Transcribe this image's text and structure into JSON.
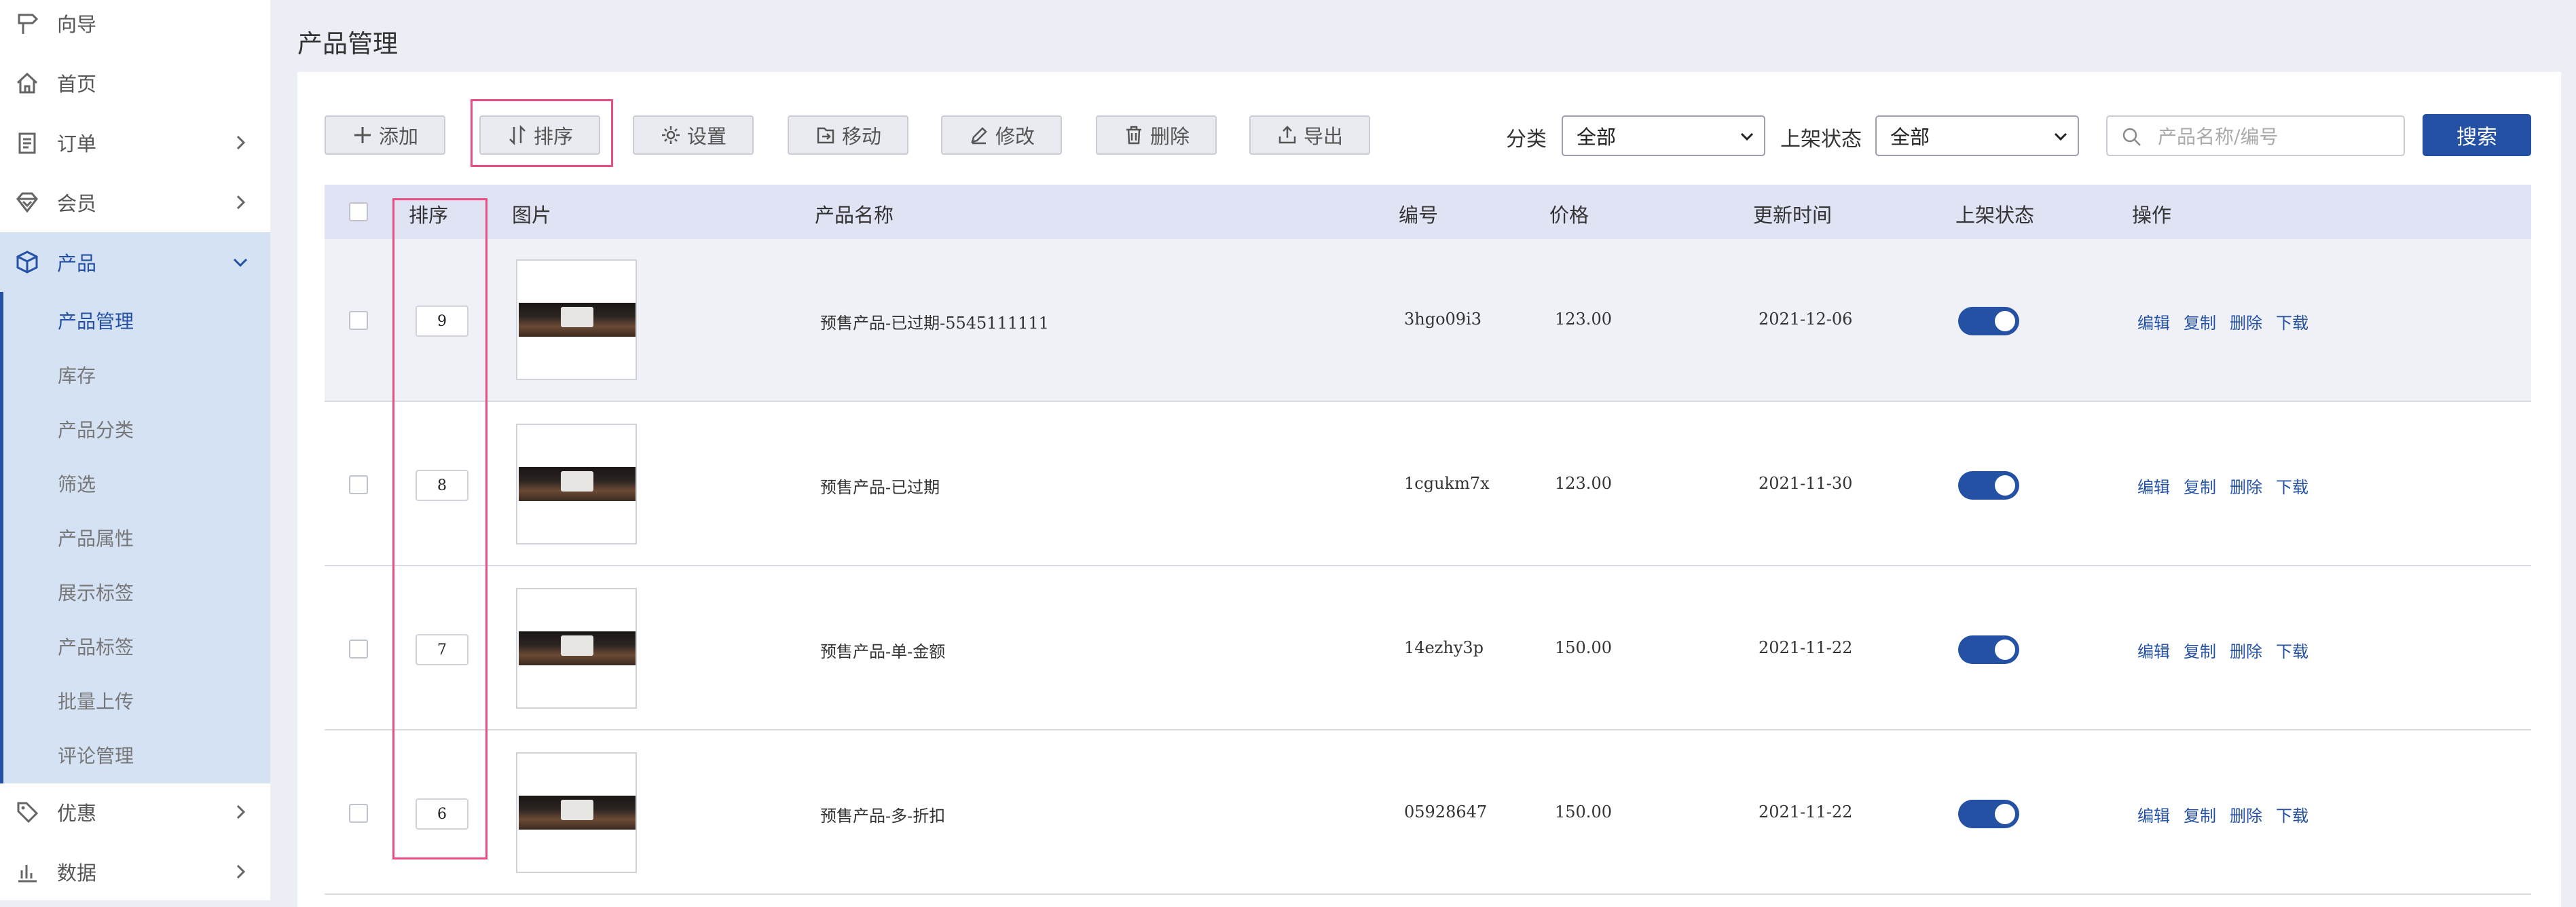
{
  "sidebar": {
    "items": [
      {
        "label": "向导",
        "icon": "signpost-icon"
      },
      {
        "label": "首页",
        "icon": "home-icon"
      },
      {
        "label": "订单",
        "icon": "clipboard-icon"
      },
      {
        "label": "会员",
        "icon": "diamond-icon"
      },
      {
        "label": "产品",
        "icon": "box-icon"
      },
      {
        "label": "优惠",
        "icon": "tag-icon"
      },
      {
        "label": "数据",
        "icon": "bar-chart-icon"
      }
    ],
    "product_sub": [
      "产品管理",
      "库存",
      "产品分类",
      "筛选",
      "产品属性",
      "展示标签",
      "产品标签",
      "批量上传",
      "评论管理"
    ]
  },
  "page": {
    "title": "产品管理"
  },
  "toolbar": {
    "add": "添加",
    "sort": "排序",
    "settings": "设置",
    "move": "移动",
    "edit": "修改",
    "delete": "删除",
    "export": "导出"
  },
  "filters": {
    "category_label": "分类",
    "category_value": "全部",
    "status_label": "上架状态",
    "status_value": "全部",
    "search_placeholder": "产品名称/编号",
    "search_button": "搜索"
  },
  "table": {
    "headers": [
      "排序",
      "图片",
      "产品名称",
      "编号",
      "价格",
      "更新时间",
      "上架状态",
      "操作"
    ],
    "actions": [
      "编辑",
      "复制",
      "删除",
      "下载"
    ],
    "rows": [
      {
        "sort": "9",
        "name": "预售产品-已过期-5545111111",
        "code": "3hgo09i3",
        "price": "123.00",
        "updated": "2021-12-06",
        "listed": true
      },
      {
        "sort": "8",
        "name": "预售产品-已过期",
        "code": "1cgukm7x",
        "price": "123.00",
        "updated": "2021-11-30",
        "listed": true
      },
      {
        "sort": "7",
        "name": "预售产品-单-金额",
        "code": "14ezhy3p",
        "price": "150.00",
        "updated": "2021-11-22",
        "listed": true
      },
      {
        "sort": "6",
        "name": "预售产品-多-折扣",
        "code": "05928647",
        "price": "150.00",
        "updated": "2021-11-22",
        "listed": true
      }
    ]
  },
  "colors": {
    "accent": "#2451a4",
    "highlight": "#ea4d7f"
  }
}
